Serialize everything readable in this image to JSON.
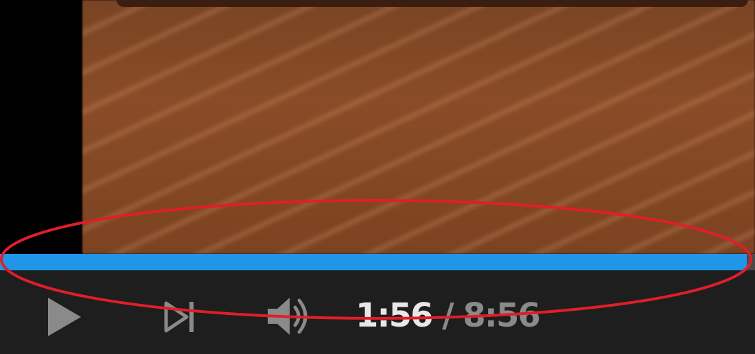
{
  "player": {
    "progress_fraction": 0.989,
    "colors": {
      "progress": "#2196e8",
      "annotation": "#e01e2a",
      "controls_bg": "#1e1e1e"
    },
    "controls": {
      "play_icon": "play-icon",
      "next_icon": "skip-next-icon",
      "volume_icon": "volume-icon"
    },
    "time": {
      "current": "1:56",
      "separator": "/",
      "duration": "8:56"
    }
  }
}
